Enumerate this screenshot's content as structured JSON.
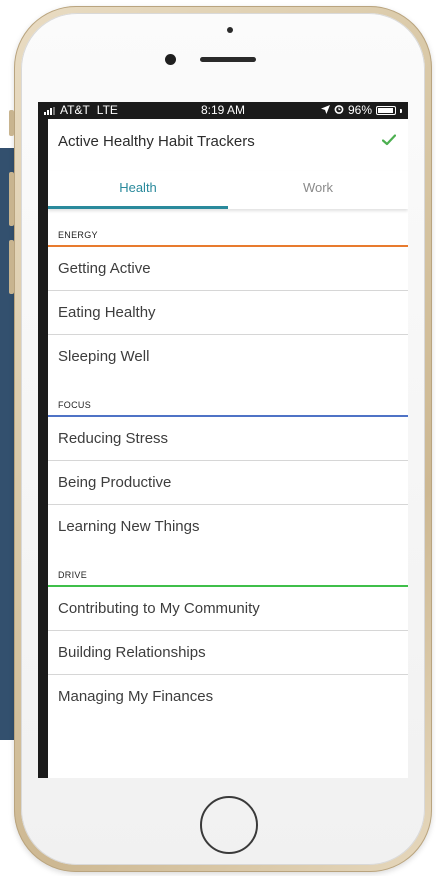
{
  "status_bar": {
    "carrier": "AT&T",
    "network": "LTE",
    "time": "8:19 AM",
    "battery": "96%",
    "battery_level": 0.96,
    "icons": [
      "signal-icon",
      "location-arrow-icon",
      "alarm-icon",
      "battery-icon"
    ]
  },
  "header": {
    "title": "Active Healthy Habit Trackers",
    "confirm_icon": "checkmark-icon",
    "confirm_color": "#4caf50"
  },
  "tabs": [
    {
      "label": "Health",
      "active": true
    },
    {
      "label": "Work",
      "active": false
    }
  ],
  "accent_color": "#2a8a9c",
  "sections": [
    {
      "title": "ENERGY",
      "color": "#e87b2e",
      "items": [
        "Getting Active",
        "Eating Healthy",
        "Sleeping Well"
      ]
    },
    {
      "title": "FOCUS",
      "color": "#4f73c6",
      "items": [
        "Reducing Stress",
        "Being Productive",
        "Learning New Things"
      ]
    },
    {
      "title": "DRIVE",
      "color": "#3fbf4a",
      "items": [
        "Contributing to My Community",
        "Building Relationships",
        "Managing My Finances"
      ]
    }
  ]
}
